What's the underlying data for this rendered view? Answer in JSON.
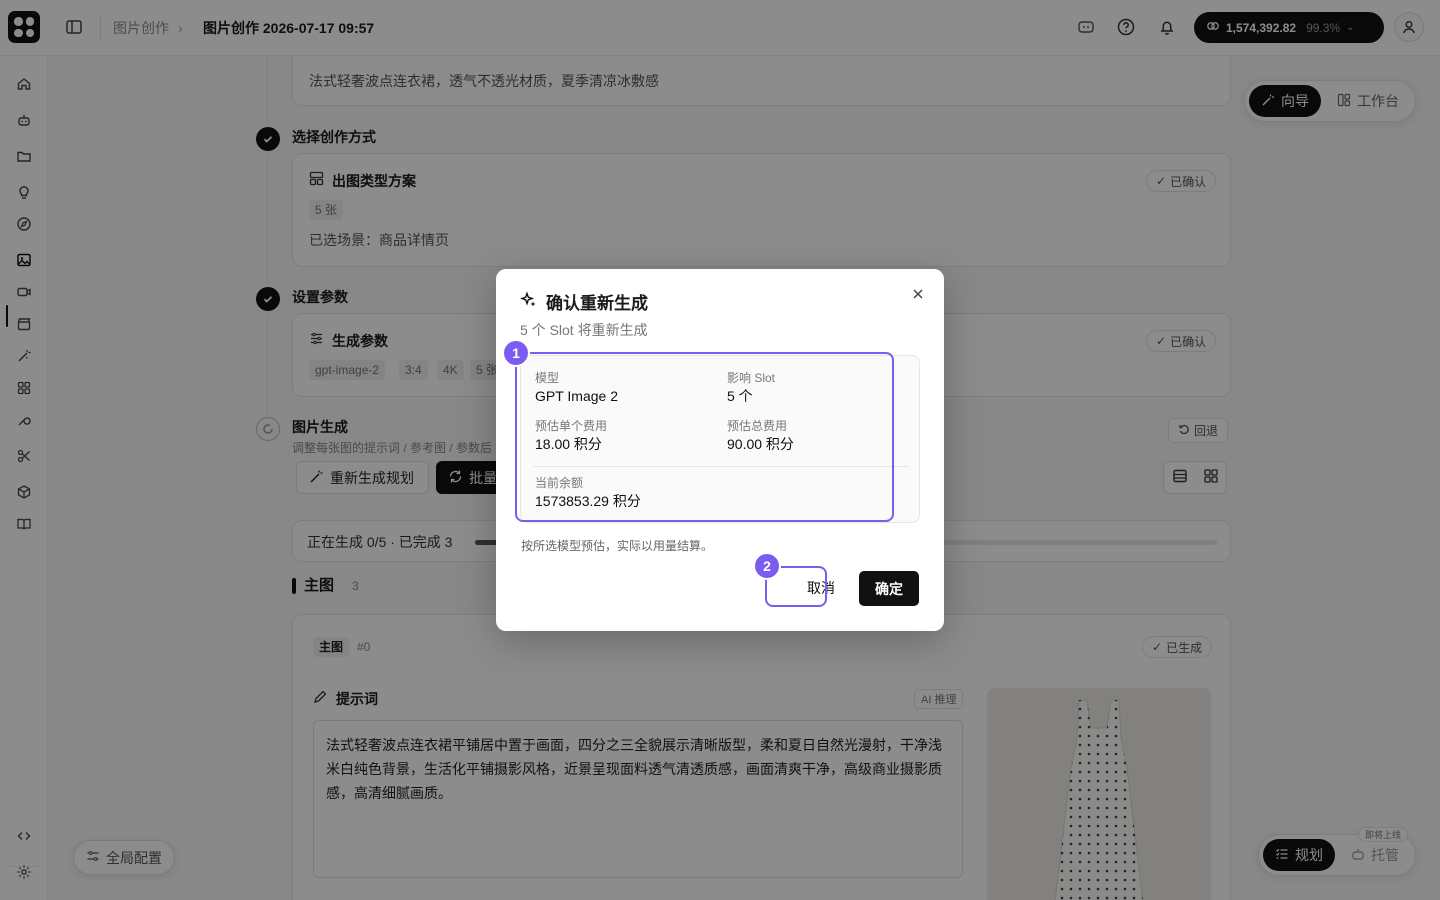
{
  "topbar": {
    "breadcrumb_parent": "图片创作",
    "breadcrumb_separator": "›",
    "breadcrumb_current": "图片创作 2026-07-17 09:57",
    "balance_amount": "1,574,392.82",
    "balance_percent": "99.3%",
    "balance_chevron": "⌄"
  },
  "rail": {
    "icons": [
      "home-icon",
      "robot-icon",
      "folder-icon",
      "lightbulb-icon",
      "compass-icon",
      "image-icon",
      "video-icon",
      "clapperboard-icon",
      "magic-wand-icon",
      "apps-grid-icon",
      "wrench-icon",
      "scissors-icon",
      "box-icon",
      "book-icon",
      "code-icon",
      "settings-icon"
    ]
  },
  "mode_toggle": {
    "guide": "向导",
    "workspace": "工作台"
  },
  "top_card": {
    "text": "法式轻奢波点连衣裙，透气不透光材质，夏季清凉冰敷感"
  },
  "steps": {
    "creation_mode": {
      "title": "选择创作方式",
      "card_title": "出图类型方案",
      "tag": "5 张",
      "scene": "已选场景：商品详情页",
      "status": "已确认"
    },
    "params": {
      "title": "设置参数",
      "card_title": "生成参数",
      "tags": [
        "gpt-image-2",
        "3:4",
        "4K",
        "5 张"
      ],
      "status": "已确认"
    },
    "generation": {
      "title": "图片生成",
      "subtitle": "调整每张图的提示词 / 参考图 / 参数后",
      "rollback": "回退",
      "regen_plan_btn": "重新生成规划",
      "batch_btn": "批量",
      "progress_text": "正在生成 0/5 · 已完成 3",
      "progress_fraction": 0.6
    }
  },
  "main_section": {
    "title": "主图",
    "count": "3",
    "item_tag": "主图",
    "item_index": "#0",
    "item_status": "已生成",
    "prompt_label": "提示词",
    "ai_badge": "AI 推理",
    "prompt_text": "法式轻奢波点连衣裙平铺居中置于画面，四分之三全貌展示清晰版型，柔和夏日自然光漫射，干净浅米白纯色背景，生活化平铺摄影风格，近景呈现面料透气清透质感，画面清爽干净，高级商业摄影质感，高清细腻画质。"
  },
  "bottom": {
    "global_config": "全局配置",
    "plan": "规划",
    "hosting": "托管",
    "coming_soon": "即将上线"
  },
  "modal": {
    "title": "确认重新生成",
    "subtitle": "5 个 Slot 将重新生成",
    "model_label": "模型",
    "model_value": "GPT Image 2",
    "slot_label": "影响 Slot",
    "slot_value": "5 个",
    "unit_cost_label": "预估单个费用",
    "unit_cost_value": "18.00 积分",
    "total_cost_label": "预估总费用",
    "total_cost_value": "90.00 积分",
    "balance_label": "当前余额",
    "balance_value": "1573853.29 积分",
    "note": "按所选模型预估，实际以用量结算。",
    "cancel": "取消",
    "confirm": "确定"
  },
  "annotations": {
    "badge1": "1",
    "badge2": "2",
    "accent": "#7c5cf0"
  }
}
